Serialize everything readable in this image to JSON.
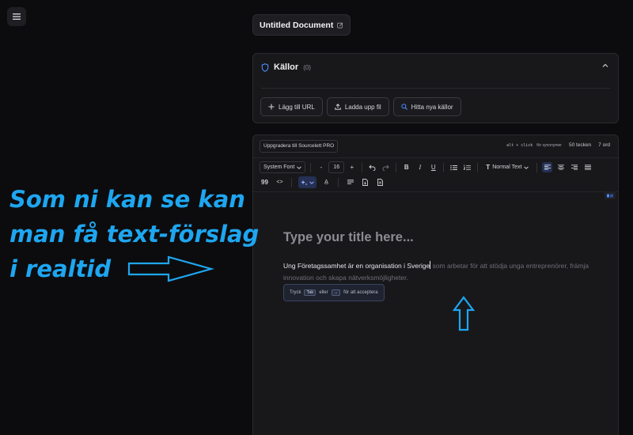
{
  "app": {
    "menu_icon": "hamburger-menu-icon"
  },
  "document": {
    "title": "Untitled Document",
    "edit_icon": "edit-icon"
  },
  "sources": {
    "title": "Källor",
    "count": "(0)",
    "buttons": [
      {
        "label": "Lägg till URL",
        "icon": "plus-icon"
      },
      {
        "label": "Ladda upp fil",
        "icon": "upload-icon"
      },
      {
        "label": "Hitta nya källor",
        "icon": "search-icon"
      }
    ]
  },
  "editor": {
    "upgrade_label": "Uppgradera till Sourcelett PRO",
    "shortcut_keys": "alt + click",
    "shortcut_desc": "för synonymer",
    "char_count": "50 tecken",
    "word_count": "7 ord",
    "toolbar": {
      "font_family": "System Font",
      "font_size": "16",
      "paragraph_style": "Normal Text"
    },
    "heading_placeholder": "Type your title here...",
    "typed_text": "Ung Företagssamhet är en organisation i Sverige",
    "suggestion_text": " som arbetar för att stödja unga entreprenörer, främja innovation och skapa nätverksmöjligheter.",
    "accept_tip": {
      "prefix": "Tryck",
      "key1": "Tab",
      "middle": "eller",
      "key2": "→",
      "suffix": "för att acceptera"
    }
  },
  "overlay": {
    "lines": [
      "Som ni kan se kan",
      "man få text-förslag",
      "i realtid"
    ],
    "color": "#1ea6f0"
  }
}
